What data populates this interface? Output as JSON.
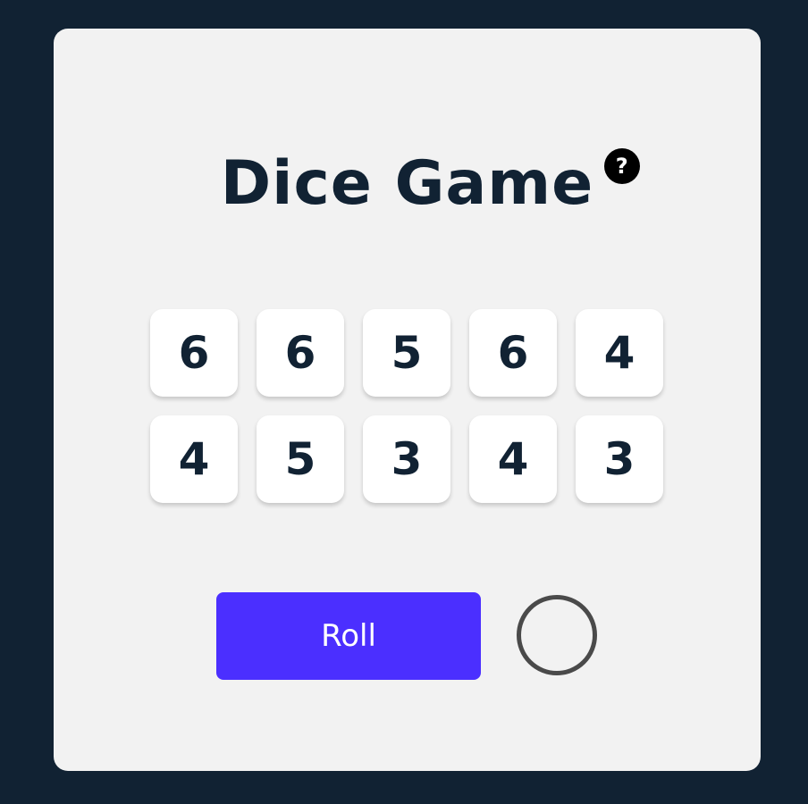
{
  "title": "Dice Game",
  "help": {
    "label": "?",
    "icon": "question-mark-icon"
  },
  "dice": [
    {
      "value": "6"
    },
    {
      "value": "6"
    },
    {
      "value": "5"
    },
    {
      "value": "6"
    },
    {
      "value": "4"
    },
    {
      "value": "4"
    },
    {
      "value": "5"
    },
    {
      "value": "3"
    },
    {
      "value": "4"
    },
    {
      "value": "3"
    }
  ],
  "roll_button": {
    "label": "Roll"
  },
  "indicator": {
    "icon": "empty-circle-indicator"
  },
  "colors": {
    "background": "#112233",
    "card": "#f2f2f2",
    "text": "#112233",
    "accent": "#4b2fff",
    "die": "#ffffff",
    "indicator_border": "#4a4a4a"
  }
}
